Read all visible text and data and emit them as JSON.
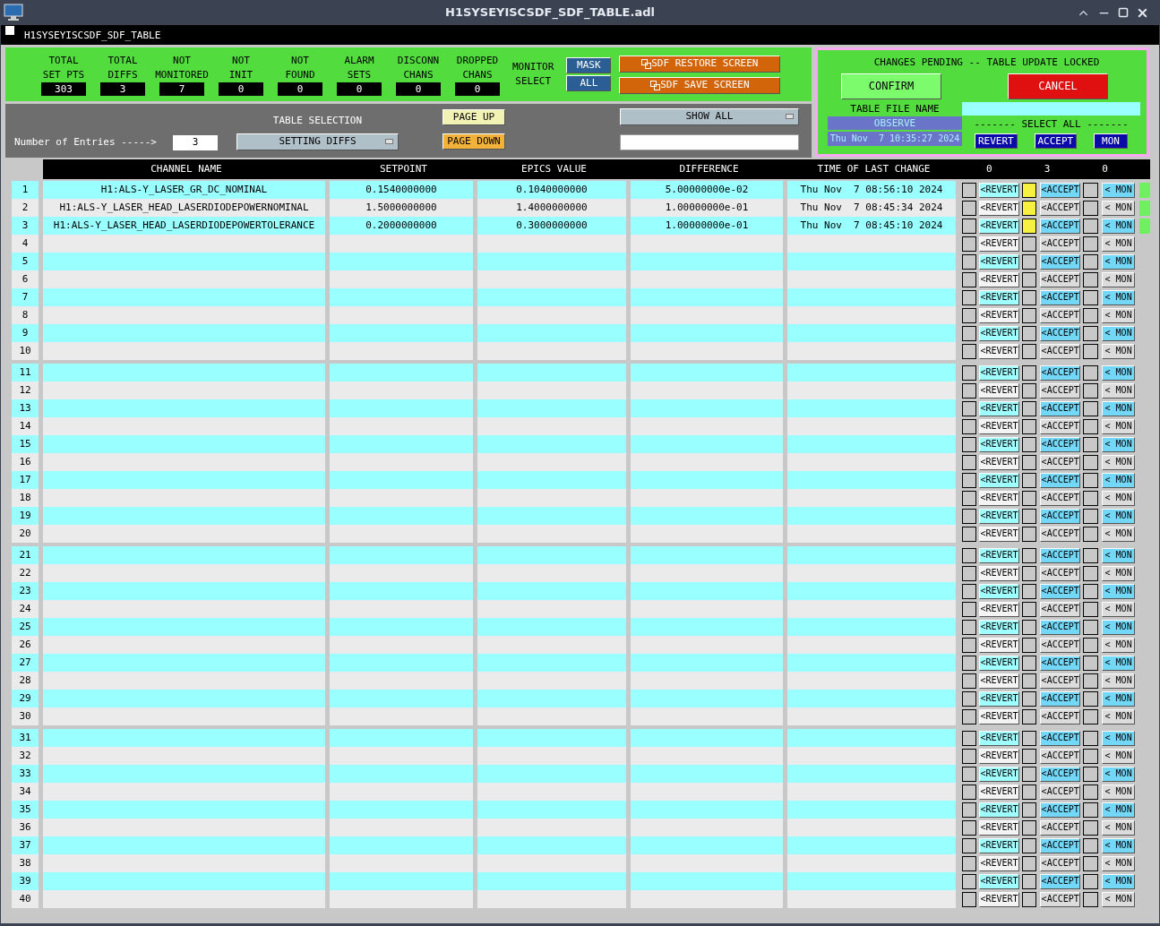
{
  "window": {
    "title": "H1SYSEYISCSDF_SDF_TABLE.adl"
  },
  "screen_title": "H1SYSEYISCSDF_SDF_TABLE",
  "stats": [
    {
      "label": [
        "TOTAL",
        "SET PTS"
      ],
      "value": "303"
    },
    {
      "label": [
        "TOTAL",
        "DIFFS"
      ],
      "value": "3"
    },
    {
      "label": [
        "NOT",
        "MONITORED"
      ],
      "value": "7"
    },
    {
      "label": [
        "NOT",
        "INIT"
      ],
      "value": "0"
    },
    {
      "label": [
        "NOT",
        "FOUND"
      ],
      "value": "0"
    },
    {
      "label": [
        "ALARM",
        "SETS"
      ],
      "value": "0"
    },
    {
      "label": [
        "DISCONN",
        "CHANS"
      ],
      "value": "0"
    },
    {
      "label": [
        "DROPPED",
        "CHANS"
      ],
      "value": "0"
    }
  ],
  "monitor_select": {
    "label": [
      "MONITOR",
      "SELECT"
    ],
    "buttons": [
      "MASK",
      "ALL"
    ]
  },
  "screen_buttons": [
    "SDF RESTORE SCREEN",
    "SDF SAVE SCREEN"
  ],
  "table_selection": {
    "label": "TABLE SELECTION",
    "entries_label": "Number of Entries ----->",
    "entries": "3",
    "selection": "SETTING DIFFS",
    "page_up": "PAGE UP",
    "page_down": "PAGE DOWN",
    "filter": "SHOW ALL"
  },
  "pending": {
    "title": "CHANGES PENDING -- TABLE UPDATE LOCKED",
    "confirm": "CONFIRM",
    "cancel": "CANCEL",
    "file_label": "TABLE FILE NAME",
    "file_name": "OBSERVE",
    "file_time": "Thu Nov  7 10:35:27 2024",
    "select_all_label": "------- SELECT ALL -------",
    "select_all_buttons": [
      "REVERT",
      "ACCEPT",
      "MON"
    ]
  },
  "table": {
    "columns": [
      "CHANNEL NAME",
      "SETPOINT",
      "EPICS VALUE",
      "DIFFERENCE",
      "TIME OF LAST CHANGE"
    ],
    "counts": [
      "0",
      "3",
      "0"
    ],
    "rows": [
      {
        "index": "1",
        "channel": "H1:ALS-Y_LASER_GR_DC_NOMINAL",
        "setpoint": "0.1540000000",
        "epics": "0.1040000000",
        "difference": "5.00000000e-02",
        "time": "Thu Nov  7 08:56:10 2024",
        "buttons": [
          "<REVERT",
          "<ACCEPT",
          "< MON"
        ],
        "revert": false,
        "accept": true,
        "monitor": false,
        "flagged": true
      },
      {
        "index": "2",
        "channel": "H1:ALS-Y_LASER_HEAD_LASERDIODEPOWERNOMINAL",
        "setpoint": "1.5000000000",
        "epics": "1.4000000000",
        "difference": "1.00000000e-01",
        "time": "Thu Nov  7 08:45:34 2024",
        "buttons": [
          "<REVERT",
          "<ACCEPT",
          "< MON"
        ],
        "revert": false,
        "accept": true,
        "monitor": false,
        "flagged": true
      },
      {
        "index": "3",
        "channel": "H1:ALS-Y_LASER_HEAD_LASERDIODEPOWERTOLERANCE",
        "setpoint": "0.2000000000",
        "epics": "0.3000000000",
        "difference": "1.00000000e-01",
        "time": "Thu Nov  7 08:45:10 2024",
        "buttons": [
          "<REVERT",
          "<ACCEPT",
          "< MON"
        ],
        "revert": false,
        "accept": true,
        "monitor": false,
        "flagged": true
      },
      {
        "index": "4",
        "buttons": [
          "<REVERT",
          "<ACCEPT",
          "< MON"
        ],
        "revert": false,
        "accept": false,
        "monitor": false,
        "flagged": false
      },
      {
        "index": "5",
        "buttons": [
          "<REVERT",
          "<ACCEPT",
          "< MON"
        ],
        "revert": false,
        "accept": false,
        "monitor": false,
        "flagged": false
      },
      {
        "index": "6",
        "buttons": [
          "<REVERT",
          "<ACCEPT",
          "< MON"
        ],
        "revert": false,
        "accept": false,
        "monitor": false,
        "flagged": false
      },
      {
        "index": "7",
        "buttons": [
          "<REVERT",
          "<ACCEPT",
          "< MON"
        ],
        "revert": false,
        "accept": false,
        "monitor": false,
        "flagged": false
      },
      {
        "index": "8",
        "buttons": [
          "<REVERT",
          "<ACCEPT",
          "< MON"
        ],
        "revert": false,
        "accept": false,
        "monitor": false,
        "flagged": false
      },
      {
        "index": "9",
        "buttons": [
          "<REVERT",
          "<ACCEPT",
          "< MON"
        ],
        "revert": false,
        "accept": false,
        "monitor": false,
        "flagged": false
      },
      {
        "index": "10",
        "buttons": [
          "<REVERT",
          "<ACCEPT",
          "< MON"
        ],
        "revert": false,
        "accept": false,
        "monitor": false,
        "flagged": false
      },
      {
        "index": "11",
        "buttons": [
          "<REVERT",
          "<ACCEPT",
          "< MON"
        ],
        "revert": false,
        "accept": false,
        "monitor": false,
        "flagged": false
      },
      {
        "index": "12",
        "buttons": [
          "<REVERT",
          "<ACCEPT",
          "< MON"
        ],
        "revert": false,
        "accept": false,
        "monitor": false,
        "flagged": false
      },
      {
        "index": "13",
        "buttons": [
          "<REVERT",
          "<ACCEPT",
          "< MON"
        ],
        "revert": false,
        "accept": false,
        "monitor": false,
        "flagged": false
      },
      {
        "index": "14",
        "buttons": [
          "<REVERT",
          "<ACCEPT",
          "< MON"
        ],
        "revert": false,
        "accept": false,
        "monitor": false,
        "flagged": false
      },
      {
        "index": "15",
        "buttons": [
          "<REVERT",
          "<ACCEPT",
          "< MON"
        ],
        "revert": false,
        "accept": false,
        "monitor": false,
        "flagged": false
      },
      {
        "index": "16",
        "buttons": [
          "<REVERT",
          "<ACCEPT",
          "< MON"
        ],
        "revert": false,
        "accept": false,
        "monitor": false,
        "flagged": false
      },
      {
        "index": "17",
        "buttons": [
          "<REVERT",
          "<ACCEPT",
          "< MON"
        ],
        "revert": false,
        "accept": false,
        "monitor": false,
        "flagged": false
      },
      {
        "index": "18",
        "buttons": [
          "<REVERT",
          "<ACCEPT",
          "< MON"
        ],
        "revert": false,
        "accept": false,
        "monitor": false,
        "flagged": false
      },
      {
        "index": "19",
        "buttons": [
          "<REVERT",
          "<ACCEPT",
          "< MON"
        ],
        "revert": false,
        "accept": false,
        "monitor": false,
        "flagged": false
      },
      {
        "index": "20",
        "buttons": [
          "<REVERT",
          "<ACCEPT",
          "< MON"
        ],
        "revert": false,
        "accept": false,
        "monitor": false,
        "flagged": false
      },
      {
        "index": "21",
        "buttons": [
          "<REVERT",
          "<ACCEPT",
          "< MON"
        ],
        "revert": false,
        "accept": false,
        "monitor": false,
        "flagged": false
      },
      {
        "index": "22",
        "buttons": [
          "<REVERT",
          "<ACCEPT",
          "< MON"
        ],
        "revert": false,
        "accept": false,
        "monitor": false,
        "flagged": false
      },
      {
        "index": "23",
        "buttons": [
          "<REVERT",
          "<ACCEPT",
          "< MON"
        ],
        "revert": false,
        "accept": false,
        "monitor": false,
        "flagged": false
      },
      {
        "index": "24",
        "buttons": [
          "<REVERT",
          "<ACCEPT",
          "< MON"
        ],
        "revert": false,
        "accept": false,
        "monitor": false,
        "flagged": false
      },
      {
        "index": "25",
        "buttons": [
          "<REVERT",
          "<ACCEPT",
          "< MON"
        ],
        "revert": false,
        "accept": false,
        "monitor": false,
        "flagged": false
      },
      {
        "index": "26",
        "buttons": [
          "<REVERT",
          "<ACCEPT",
          "< MON"
        ],
        "revert": false,
        "accept": false,
        "monitor": false,
        "flagged": false
      },
      {
        "index": "27",
        "buttons": [
          "<REVERT",
          "<ACCEPT",
          "< MON"
        ],
        "revert": false,
        "accept": false,
        "monitor": false,
        "flagged": false
      },
      {
        "index": "28",
        "buttons": [
          "<REVERT",
          "<ACCEPT",
          "< MON"
        ],
        "revert": false,
        "accept": false,
        "monitor": false,
        "flagged": false
      },
      {
        "index": "29",
        "buttons": [
          "<REVERT",
          "<ACCEPT",
          "< MON"
        ],
        "revert": false,
        "accept": false,
        "monitor": false,
        "flagged": false
      },
      {
        "index": "30",
        "buttons": [
          "<REVERT",
          "<ACCEPT",
          "< MON"
        ],
        "revert": false,
        "accept": false,
        "monitor": false,
        "flagged": false
      },
      {
        "index": "31",
        "buttons": [
          "<REVERT",
          "<ACCEPT",
          "< MON"
        ],
        "revert": false,
        "accept": false,
        "monitor": false,
        "flagged": false
      },
      {
        "index": "32",
        "buttons": [
          "<REVERT",
          "<ACCEPT",
          "< MON"
        ],
        "revert": false,
        "accept": false,
        "monitor": false,
        "flagged": false
      },
      {
        "index": "33",
        "buttons": [
          "<REVERT",
          "<ACCEPT",
          "< MON"
        ],
        "revert": false,
        "accept": false,
        "monitor": false,
        "flagged": false
      },
      {
        "index": "34",
        "buttons": [
          "<REVERT",
          "<ACCEPT",
          "< MON"
        ],
        "revert": false,
        "accept": false,
        "monitor": false,
        "flagged": false
      },
      {
        "index": "35",
        "buttons": [
          "<REVERT",
          "<ACCEPT",
          "< MON"
        ],
        "revert": false,
        "accept": false,
        "monitor": false,
        "flagged": false
      },
      {
        "index": "36",
        "buttons": [
          "<REVERT",
          "<ACCEPT",
          "< MON"
        ],
        "revert": false,
        "accept": false,
        "monitor": false,
        "flagged": false
      },
      {
        "index": "37",
        "buttons": [
          "<REVERT",
          "<ACCEPT",
          "< MON"
        ],
        "revert": false,
        "accept": false,
        "monitor": false,
        "flagged": false
      },
      {
        "index": "38",
        "buttons": [
          "<REVERT",
          "<ACCEPT",
          "< MON"
        ],
        "revert": false,
        "accept": false,
        "monitor": false,
        "flagged": false
      },
      {
        "index": "39",
        "buttons": [
          "<REVERT",
          "<ACCEPT",
          "< MON"
        ],
        "revert": false,
        "accept": false,
        "monitor": false,
        "flagged": false
      },
      {
        "index": "40",
        "buttons": [
          "<REVERT",
          "<ACCEPT",
          "< MON"
        ],
        "revert": false,
        "accept": false,
        "monitor": false,
        "flagged": false
      }
    ]
  }
}
